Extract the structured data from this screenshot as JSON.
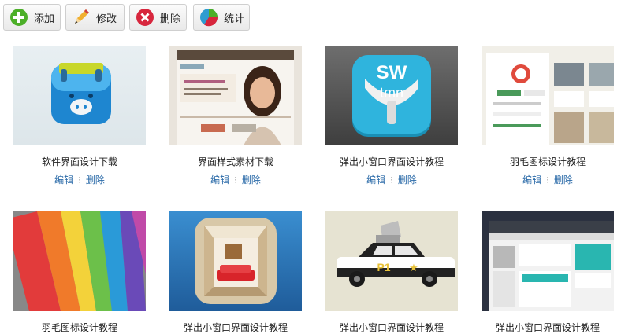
{
  "toolbar": {
    "add": {
      "label": "添加",
      "icon": "plus-circle-icon",
      "color": "#4caf28"
    },
    "edit": {
      "label": "修改",
      "icon": "pencil-icon",
      "color": "#e0a020"
    },
    "delete": {
      "label": "删除",
      "icon": "close-circle-icon",
      "color": "#d7263d"
    },
    "stats": {
      "label": "统计",
      "icon": "pie-chart-icon",
      "color": "#2e9cd0"
    }
  },
  "cards": [
    {
      "title": "软件界面设计下载",
      "edit": "编辑",
      "delete": "删除",
      "thumb": "pig-app-icon"
    },
    {
      "title": "界面样式素材下载",
      "edit": "编辑",
      "delete": "删除",
      "thumb": "website-woman-screenshot"
    },
    {
      "title": "弹出小窗口界面设计教程",
      "edit": "编辑",
      "delete": "删除",
      "thumb": "swtmn-app-icon",
      "thumb_text": "SW tmn"
    },
    {
      "title": "羽毛图标设计教程",
      "edit": "编辑",
      "delete": "删除",
      "thumb": "real-estate-ui-screenshot"
    },
    {
      "title": "羽毛图标设计教程",
      "thumb": "rainbow-umbrellas-photo"
    },
    {
      "title": "弹出小窗口界面设计教程",
      "thumb": "room-app-icon"
    },
    {
      "title": "弹出小窗口界面设计教程",
      "thumb": "police-car-illustration",
      "thumb_text": "P1"
    },
    {
      "title": "弹出小窗口界面设计教程",
      "thumb": "dashboard-ui-screenshot"
    }
  ]
}
